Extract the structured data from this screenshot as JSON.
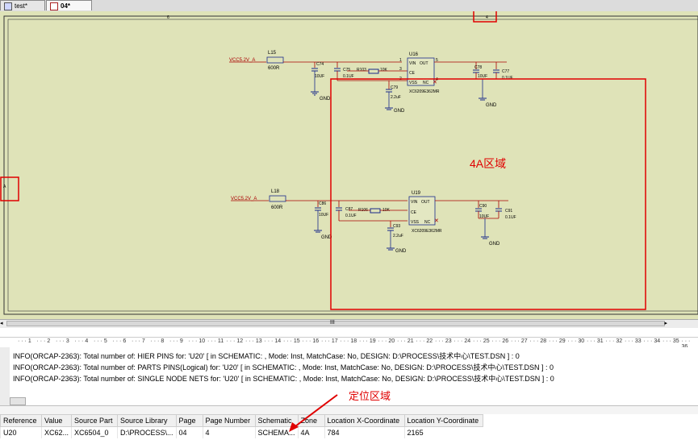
{
  "tabs": [
    {
      "label": "test*"
    },
    {
      "label": "04*"
    }
  ],
  "schematic": {
    "border_tick_top": "6",
    "border_tick_top2": "4",
    "border_tick_left": "A",
    "zone_label": "4A区域",
    "circuit1": {
      "net": "VCC5.2V_A",
      "inductor": "L15",
      "ind_val": "600R",
      "c_in1": "C74",
      "c_in1_val": "10UF",
      "c_in2": "C75",
      "c_in2_val": "0.1UF",
      "resistor": "R103",
      "res_val": "10K",
      "ic": "U16",
      "ic_part": "XC6209E362MR",
      "c_ce": "C79",
      "c_ce_val": "2.2uF",
      "c_out1": "C78",
      "c_out1_val": "10UF",
      "c_out2": "C77",
      "c_out2_val": "0.1UF",
      "gnd": "GND"
    },
    "circuit2": {
      "net": "VCC5.2V_A",
      "inductor": "L18",
      "ind_val": "600R",
      "c_in1": "C86",
      "c_in1_val": "10UF",
      "c_in2": "C87",
      "c_in2_val": "0.1UF",
      "resistor": "R106",
      "res_val": "10K",
      "ic": "U19",
      "ic_part": "XC6209E362MR",
      "c_ce": "C93",
      "c_ce_val": "2.2uF",
      "c_out1": "C90",
      "c_out1_val": "10UF",
      "c_out2": "C91",
      "c_out2_val": "0.1UF",
      "gnd": "GND"
    },
    "pins": {
      "vin": "VIN",
      "out": "OUT",
      "ce": "CE",
      "vss": "VSS",
      "nc": "NC",
      "p1": "1",
      "p2": "2",
      "p3": "3",
      "p4": "4",
      "p5": "5"
    }
  },
  "hscroll": {
    "thumb_mark": "III",
    "left_arrow": "◂",
    "right_arrow": "▸"
  },
  "ruler": [
    "1",
    "2",
    "3",
    "4",
    "5",
    "6",
    "7",
    "8",
    "9",
    "10",
    "11",
    "12",
    "13",
    "14",
    "15",
    "16",
    "17",
    "18",
    "19",
    "20",
    "21",
    "22",
    "23",
    "24",
    "25",
    "26",
    "27",
    "28",
    "29",
    "30",
    "31",
    "32",
    "33",
    "34",
    "35",
    "36"
  ],
  "session_log": [
    "INFO(ORCAP-2363): Total number of: HIER PINS for: 'U20' [ in SCHEMATIC: , Mode: Inst, MatchCase: No, DESIGN: D:\\PROCESS\\技术中心\\TEST.DSN ] : 0",
    "INFO(ORCAP-2363): Total number of: PARTS PINS(Logical) for: 'U20' [ in SCHEMATIC: , Mode: Inst, MatchCase: No, DESIGN: D:\\PROCESS\\技术中心\\TEST.DSN ] : 0",
    "INFO(ORCAP-2363): Total number of: SINGLE NODE NETS for: 'U20' [ in SCHEMATIC: , Mode: Inst, MatchCase: No, DESIGN: D:\\PROCESS\\技术中心\\TEST.DSN ] : 0"
  ],
  "locate_label": "定位区域",
  "results": {
    "columns": [
      "Reference",
      "Value",
      "Source Part",
      "Source Library",
      "Page",
      "Page Number",
      "Schematic",
      "Zone",
      "Location X-Coordinate",
      "Location Y-Coordinate"
    ],
    "rows": [
      [
        "U20",
        "XC62...",
        "XC6504_0",
        "D:\\PROCESS\\...",
        "04",
        "4",
        "SCHEMA...",
        "4A",
        "784",
        "2165"
      ]
    ]
  },
  "colors": {
    "wire": "#aa0000",
    "symbol": "#1a2a8a",
    "highlight": "#e00000",
    "canvas": "#dfe3b8"
  }
}
